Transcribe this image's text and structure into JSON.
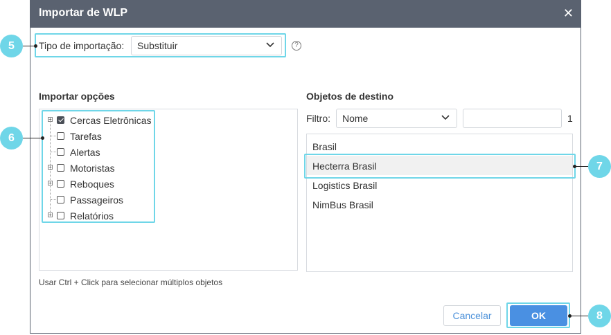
{
  "dialog": {
    "title": "Importar de WLP",
    "close_glyph": "✕"
  },
  "import_type": {
    "label": "Tipo de importação:",
    "selected": "Substituir",
    "help_glyph": "?"
  },
  "options": {
    "heading": "Importar opções",
    "items": [
      {
        "label": "Cercas Eletrônicas",
        "checked": true,
        "expandable": true
      },
      {
        "label": "Tarefas",
        "checked": false,
        "expandable": false
      },
      {
        "label": "Alertas",
        "checked": false,
        "expandable": false
      },
      {
        "label": "Motoristas",
        "checked": false,
        "expandable": true
      },
      {
        "label": "Reboques",
        "checked": false,
        "expandable": true
      },
      {
        "label": "Passageiros",
        "checked": false,
        "expandable": false
      },
      {
        "label": "Relatórios",
        "checked": false,
        "expandable": true
      }
    ],
    "hint": "Usar Ctrl + Click para selecionar múltiplos objetos"
  },
  "destination": {
    "heading": "Objetos de destino",
    "filter_label": "Filtro:",
    "filter_select": "Nome",
    "filter_value": "",
    "count": "1",
    "objects": [
      {
        "name": "Brasil",
        "selected": false
      },
      {
        "name": "Hecterra Brasil",
        "selected": true
      },
      {
        "name": "Logistics Brasil",
        "selected": false
      },
      {
        "name": "NimBus Brasil",
        "selected": false
      }
    ]
  },
  "buttons": {
    "cancel": "Cancelar",
    "ok": "OK"
  },
  "callouts": [
    "5",
    "6",
    "7",
    "8"
  ],
  "colors": {
    "titlebar": "#5a6270",
    "highlight": "#6fd6e8",
    "ok_button": "#4a90e2"
  }
}
